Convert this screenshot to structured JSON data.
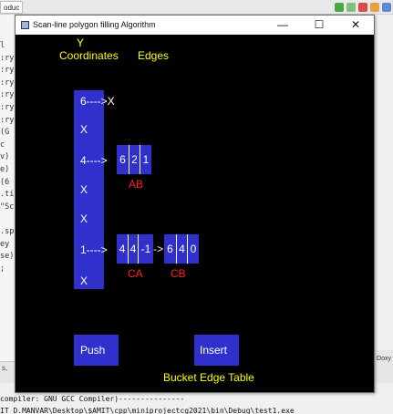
{
  "window": {
    "title": "Scan-line polygon filling Algorithm",
    "minimize": "—",
    "maximize": "☐",
    "close": "✕"
  },
  "background": {
    "tab_label": "oduc",
    "code_fragments": [
      "l",
      ":ry",
      ":ry",
      ":ry",
      ":ry",
      ":ry",
      ":ry",
      "(G",
      "c",
      "v)",
      "e)",
      "(6",
      ".ti",
      "\"Sc",
      "",
      ".sp",
      "ey",
      "se)",
      ";"
    ],
    "logs_left": "s,",
    "logs_right": "Doxy",
    "log_line_1": "compiler: GNU GCC Compiler)---------------",
    "log_line_2": "IT D.MANVAR\\Desktop\\$AMIT\\cpp\\miniprojectcg2021\\bin\\Debug\\test1.exe"
  },
  "labels": {
    "y_header": "Y",
    "coordinates_header": "Coordinates",
    "edges_header": "Edges",
    "bucket_edge_table": "Bucket Edge Table"
  },
  "y_column": {
    "rows": [
      {
        "text": "6---->X"
      },
      {
        "text": "X"
      },
      {
        "text": "4----> "
      },
      {
        "text": "X"
      },
      {
        "text": "X"
      },
      {
        "text": "1----> "
      },
      {
        "text": "X"
      }
    ]
  },
  "edge_nodes": [
    {
      "cells": [
        "6",
        "2",
        "1"
      ],
      "label": "AB"
    },
    {
      "cells": [
        "4",
        "4",
        "-1"
      ],
      "label": "CA"
    },
    {
      "cells": [
        "6",
        "4",
        "0"
      ],
      "label": "CB"
    }
  ],
  "link_arrow": "->",
  "buttons": {
    "push": "Push",
    "insert": "Insert"
  },
  "colors": {
    "canvas_bg": "#000000",
    "block_blue": "#3030cc",
    "header_yellow": "#ffff00",
    "edge_label_red": "#ff2020",
    "text_white": "#ffffff"
  }
}
